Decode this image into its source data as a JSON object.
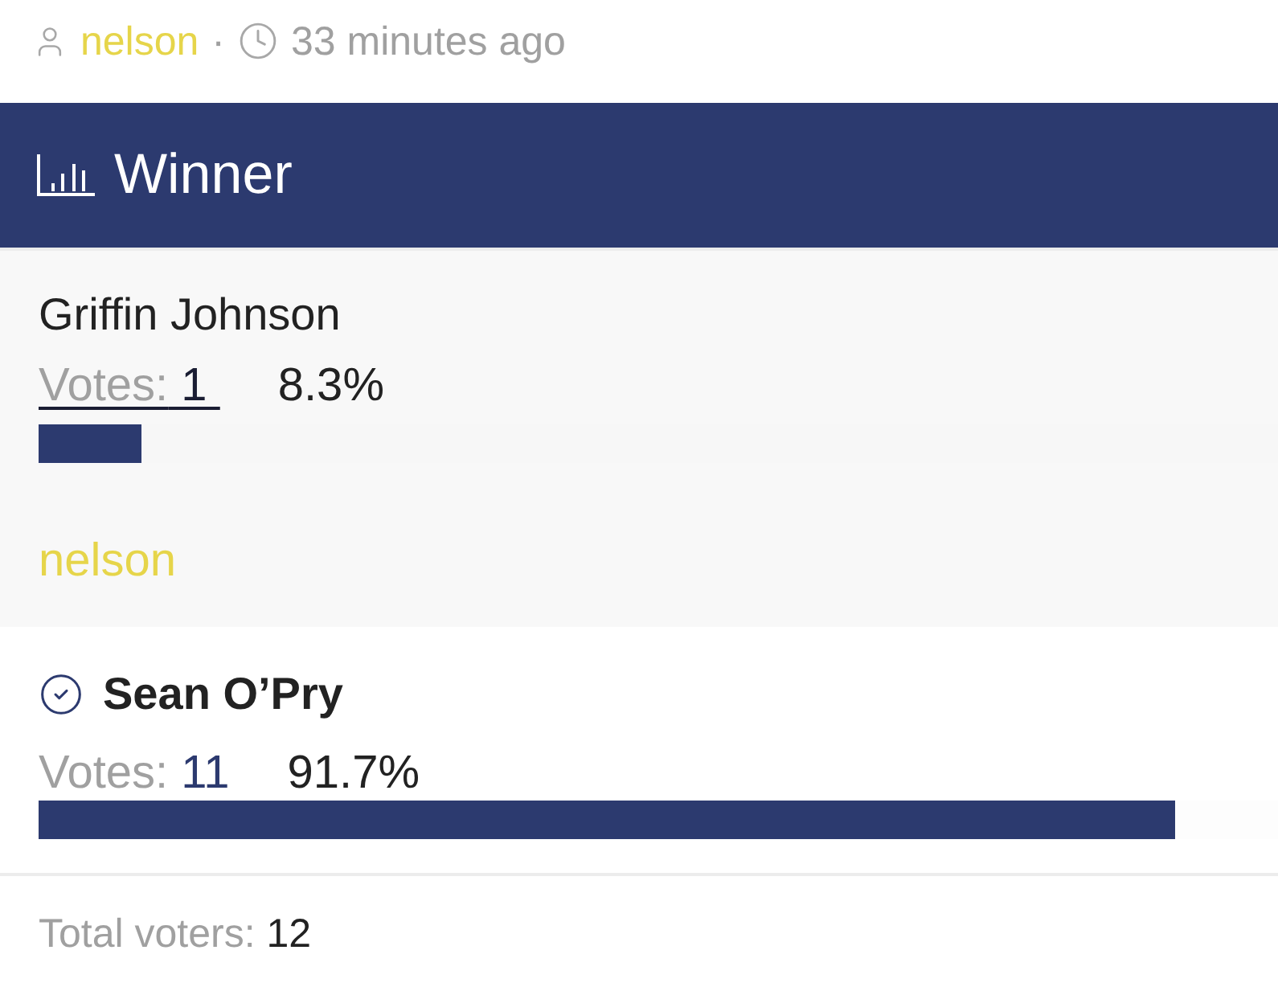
{
  "meta": {
    "author": "nelson",
    "separator": "·",
    "time": "33 minutes ago"
  },
  "header": {
    "title": "Winner"
  },
  "options": [
    {
      "name": "Griffin Johnson",
      "voted": false,
      "expanded": true,
      "votes_label": "Votes:",
      "votes": "1",
      "percent": "8.3%",
      "level": 0.083,
      "voters": [
        "nelson"
      ]
    },
    {
      "name": "Sean O’Pry",
      "voted": true,
      "expanded": false,
      "votes_label": "Votes:",
      "votes": "11",
      "percent": "91.7%",
      "level": 0.917
    }
  ],
  "footer": {
    "label": "Total voters:",
    "value": "12"
  }
}
